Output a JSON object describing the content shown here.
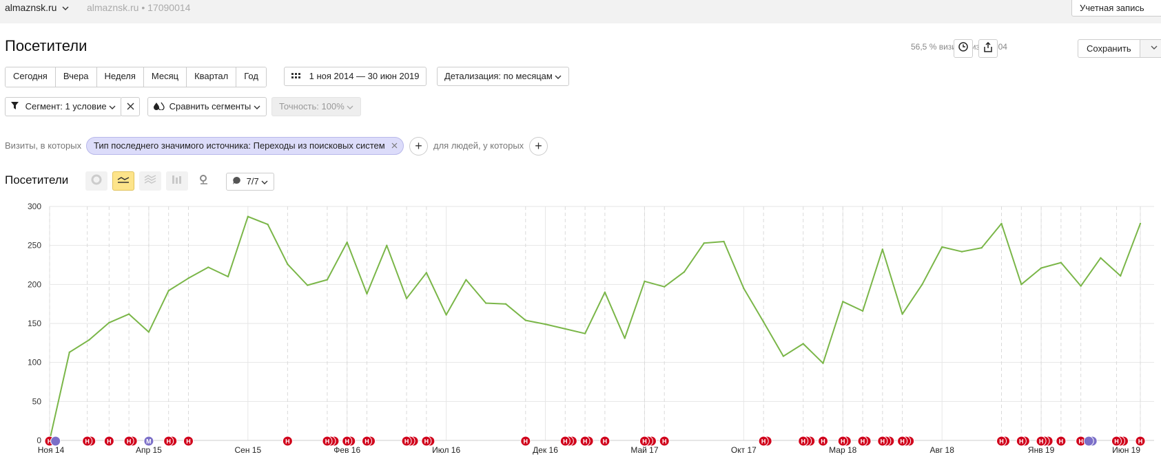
{
  "header": {
    "site": "almaznsk.ru",
    "counter": "almaznsk.ru • 17090014",
    "account": "Учетная запись"
  },
  "page": {
    "title": "Посетители",
    "share_text": "56,5 % визитов из 24 704",
    "save_label": "Сохранить"
  },
  "periods": [
    "Сегодня",
    "Вчера",
    "Неделя",
    "Месяц",
    "Квартал",
    "Год"
  ],
  "date_range": "1 ноя 2014 — 30 июн 2019",
  "detail": "Детализация: по месяцам",
  "segment": {
    "label": "Сегмент: 1 условие",
    "compare": "Сравнить сегменты",
    "accuracy": "Точность: 100%"
  },
  "filters": {
    "prefix": "Визиты, в которых",
    "chip": "Тип последнего значимого источника: Переходы из поисковых систем",
    "people": "для людей, у которых"
  },
  "chart_toolbar": {
    "title": "Посетители",
    "notes": "7/7",
    "types": [
      "pie-chart-icon",
      "line-chart-icon",
      "area-chart-icon",
      "bar-chart-icon",
      "map-icon"
    ],
    "active_type": "line-chart-icon"
  },
  "colors": {
    "line": "#7ab648",
    "note_red": "#d0021b",
    "note_purple": "#7b6fc8",
    "grid": "#e6e6e6",
    "chip_bg": "#dcdcfa"
  },
  "chart_data": {
    "type": "line",
    "series": [
      {
        "values": [
          0,
          113,
          129,
          151,
          162,
          139,
          192,
          208,
          222,
          210,
          287,
          277,
          226,
          199,
          206,
          254,
          188,
          250,
          182,
          215,
          161,
          206,
          176,
          175,
          154,
          149,
          143,
          137,
          190,
          131,
          204,
          197,
          216,
          253,
          255,
          195,
          152,
          108,
          124,
          99,
          178,
          166,
          245,
          162,
          200,
          248,
          242,
          247,
          278,
          200,
          221,
          228,
          198,
          234,
          211,
          278
        ]
      }
    ],
    "x_start": "2014-11",
    "x_end": "2019-06",
    "x_tick_labels": [
      "Ноя 14",
      "Апр 15",
      "Сен 15",
      "Фев 16",
      "Июл 16",
      "Дек 16",
      "Май 17",
      "Окт 17",
      "Мар 18",
      "Авг 18",
      "Янв 19",
      "Июн 19"
    ],
    "y_ticks": [
      0,
      50,
      100,
      150,
      200,
      250,
      300
    ],
    "ylim": [
      0,
      300
    ],
    "grid": true,
    "note_months": [
      {
        "i": 0,
        "n": 1,
        "t": "Н"
      },
      {
        "i": 0.3,
        "n": 1,
        "t": "",
        "purple": true
      },
      {
        "i": 1.9,
        "n": 2,
        "t": "Н"
      },
      {
        "i": 3,
        "n": 1,
        "t": "Н"
      },
      {
        "i": 4,
        "n": 2,
        "t": "Н"
      },
      {
        "i": 5,
        "n": 1,
        "t": "М",
        "purple": true
      },
      {
        "i": 6,
        "n": 2,
        "t": "Н"
      },
      {
        "i": 7,
        "n": 1,
        "t": "Н"
      },
      {
        "i": 12,
        "n": 1,
        "t": "Н"
      },
      {
        "i": 14,
        "n": 3,
        "t": "Н"
      },
      {
        "i": 15,
        "n": 2,
        "t": "Н"
      },
      {
        "i": 16,
        "n": 2,
        "t": "Н"
      },
      {
        "i": 18,
        "n": 3,
        "t": "Н"
      },
      {
        "i": 19,
        "n": 2,
        "t": "Н"
      },
      {
        "i": 24,
        "n": 1,
        "t": "Н"
      },
      {
        "i": 26,
        "n": 3,
        "t": "Н"
      },
      {
        "i": 27,
        "n": 2,
        "t": "Н"
      },
      {
        "i": 28,
        "n": 1,
        "t": "Н"
      },
      {
        "i": 30,
        "n": 3,
        "t": "Н"
      },
      {
        "i": 31,
        "n": 1,
        "t": "Н"
      },
      {
        "i": 36,
        "n": 2,
        "t": "Н"
      },
      {
        "i": 38,
        "n": 3,
        "t": "Н"
      },
      {
        "i": 39,
        "n": 1,
        "t": "Н"
      },
      {
        "i": 40,
        "n": 2,
        "t": "Н"
      },
      {
        "i": 41,
        "n": 2,
        "t": "Н"
      },
      {
        "i": 42,
        "n": 3,
        "t": "Н"
      },
      {
        "i": 43,
        "n": 3,
        "t": "Н"
      },
      {
        "i": 48,
        "n": 2,
        "t": "Н"
      },
      {
        "i": 49,
        "n": 2,
        "t": "Н"
      },
      {
        "i": 50,
        "n": 3,
        "t": "Н"
      },
      {
        "i": 51,
        "n": 1,
        "t": "Н"
      },
      {
        "i": 52,
        "n": 1,
        "t": "Н"
      },
      {
        "i": 52.4,
        "n": 2,
        "t": "",
        "purple": true
      },
      {
        "i": 53.8,
        "n": 3,
        "t": "Н"
      },
      {
        "i": 55,
        "n": 1,
        "t": "Н"
      }
    ]
  }
}
